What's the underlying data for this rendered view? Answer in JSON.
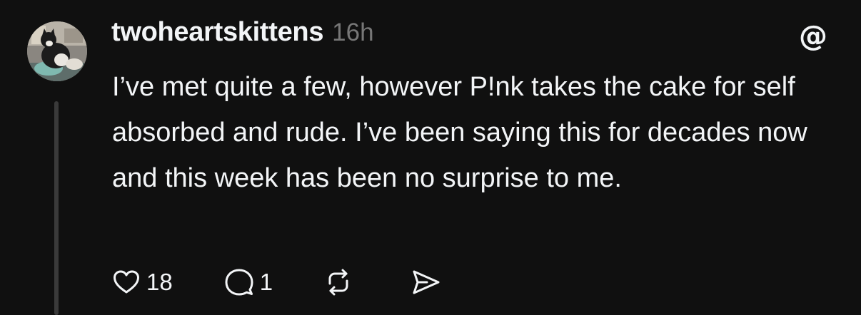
{
  "post": {
    "username": "twoheartskittens",
    "timestamp": "16h",
    "text": "I’ve met quite a few, however P!nk takes the cake for self absorbed and rude. I’ve been saying this for decades now and this week has been no surprise to me.",
    "likes_count": "18",
    "replies_count": "1"
  },
  "icons": {
    "logo": "threads-logo-icon",
    "like": "heart-icon",
    "reply": "comment-icon",
    "repost": "repost-icon",
    "share": "send-icon"
  },
  "colors": {
    "background": "#101010",
    "text": "#f3f5f7",
    "muted": "#777777",
    "thread_line": "#3a3a3a"
  }
}
